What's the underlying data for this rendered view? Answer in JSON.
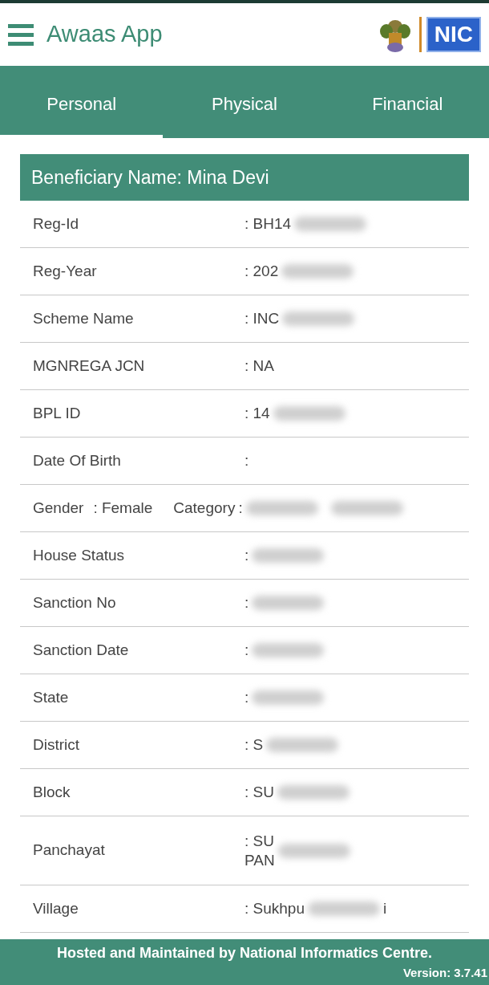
{
  "app_bar": {
    "title": "Awaas App",
    "logo_text": "NIC"
  },
  "tabs": [
    {
      "label": "Personal",
      "selected": true
    },
    {
      "label": "Physical",
      "selected": false
    },
    {
      "label": "Financial",
      "selected": false
    }
  ],
  "card": {
    "title": "Beneficiary Name: Mina Devi",
    "rows": [
      {
        "kind": "field",
        "label": "Reg-Id",
        "value_lines": [
          ": BH14"
        ],
        "redacted": true
      },
      {
        "kind": "field",
        "label": "Reg-Year",
        "value_lines": [
          ": 202"
        ],
        "redacted": true
      },
      {
        "kind": "field",
        "label": "Scheme Name",
        "value_lines": [
          ": INC"
        ],
        "redacted": true
      },
      {
        "kind": "field",
        "label": "MGNREGA JCN",
        "value_lines": [
          ": NA"
        ],
        "redacted": false
      },
      {
        "kind": "field",
        "label": "BPL ID",
        "value_lines": [
          ": 14"
        ],
        "redacted": true
      },
      {
        "kind": "field",
        "label": "Date Of Birth",
        "value_lines": [
          ":"
        ],
        "redacted": false
      },
      {
        "kind": "pair",
        "label": "Gender",
        "value_lines": [
          ": Female"
        ],
        "label_2": "Category",
        "value_2": ":",
        "redacted": true
      },
      {
        "kind": "field",
        "label": "House Status",
        "value_lines": [
          ":"
        ],
        "redacted": true
      },
      {
        "kind": "field",
        "label": "Sanction No",
        "value_lines": [
          ":"
        ],
        "redacted": true
      },
      {
        "kind": "field",
        "label": "Sanction Date",
        "value_lines": [
          ":"
        ],
        "redacted": true
      },
      {
        "kind": "field",
        "label": "State",
        "value_lines": [
          ":"
        ],
        "redacted": true
      },
      {
        "kind": "field",
        "label": "District",
        "value_lines": [
          ": S"
        ],
        "redacted": true
      },
      {
        "kind": "field",
        "label": "Block",
        "value_lines": [
          ": SU"
        ],
        "redacted": true
      },
      {
        "kind": "field",
        "label": "Panchayat",
        "value_lines": [
          ": SU",
          "PAN"
        ],
        "redacted": true
      },
      {
        "kind": "field",
        "label": "Village",
        "value_lines": [
          ": Sukhpu"
        ],
        "value_after": "i",
        "redacted": true
      }
    ]
  },
  "footer": {
    "text": "Hosted and Maintained by National Informatics Centre.",
    "version": "Version: 3.7.41"
  }
}
